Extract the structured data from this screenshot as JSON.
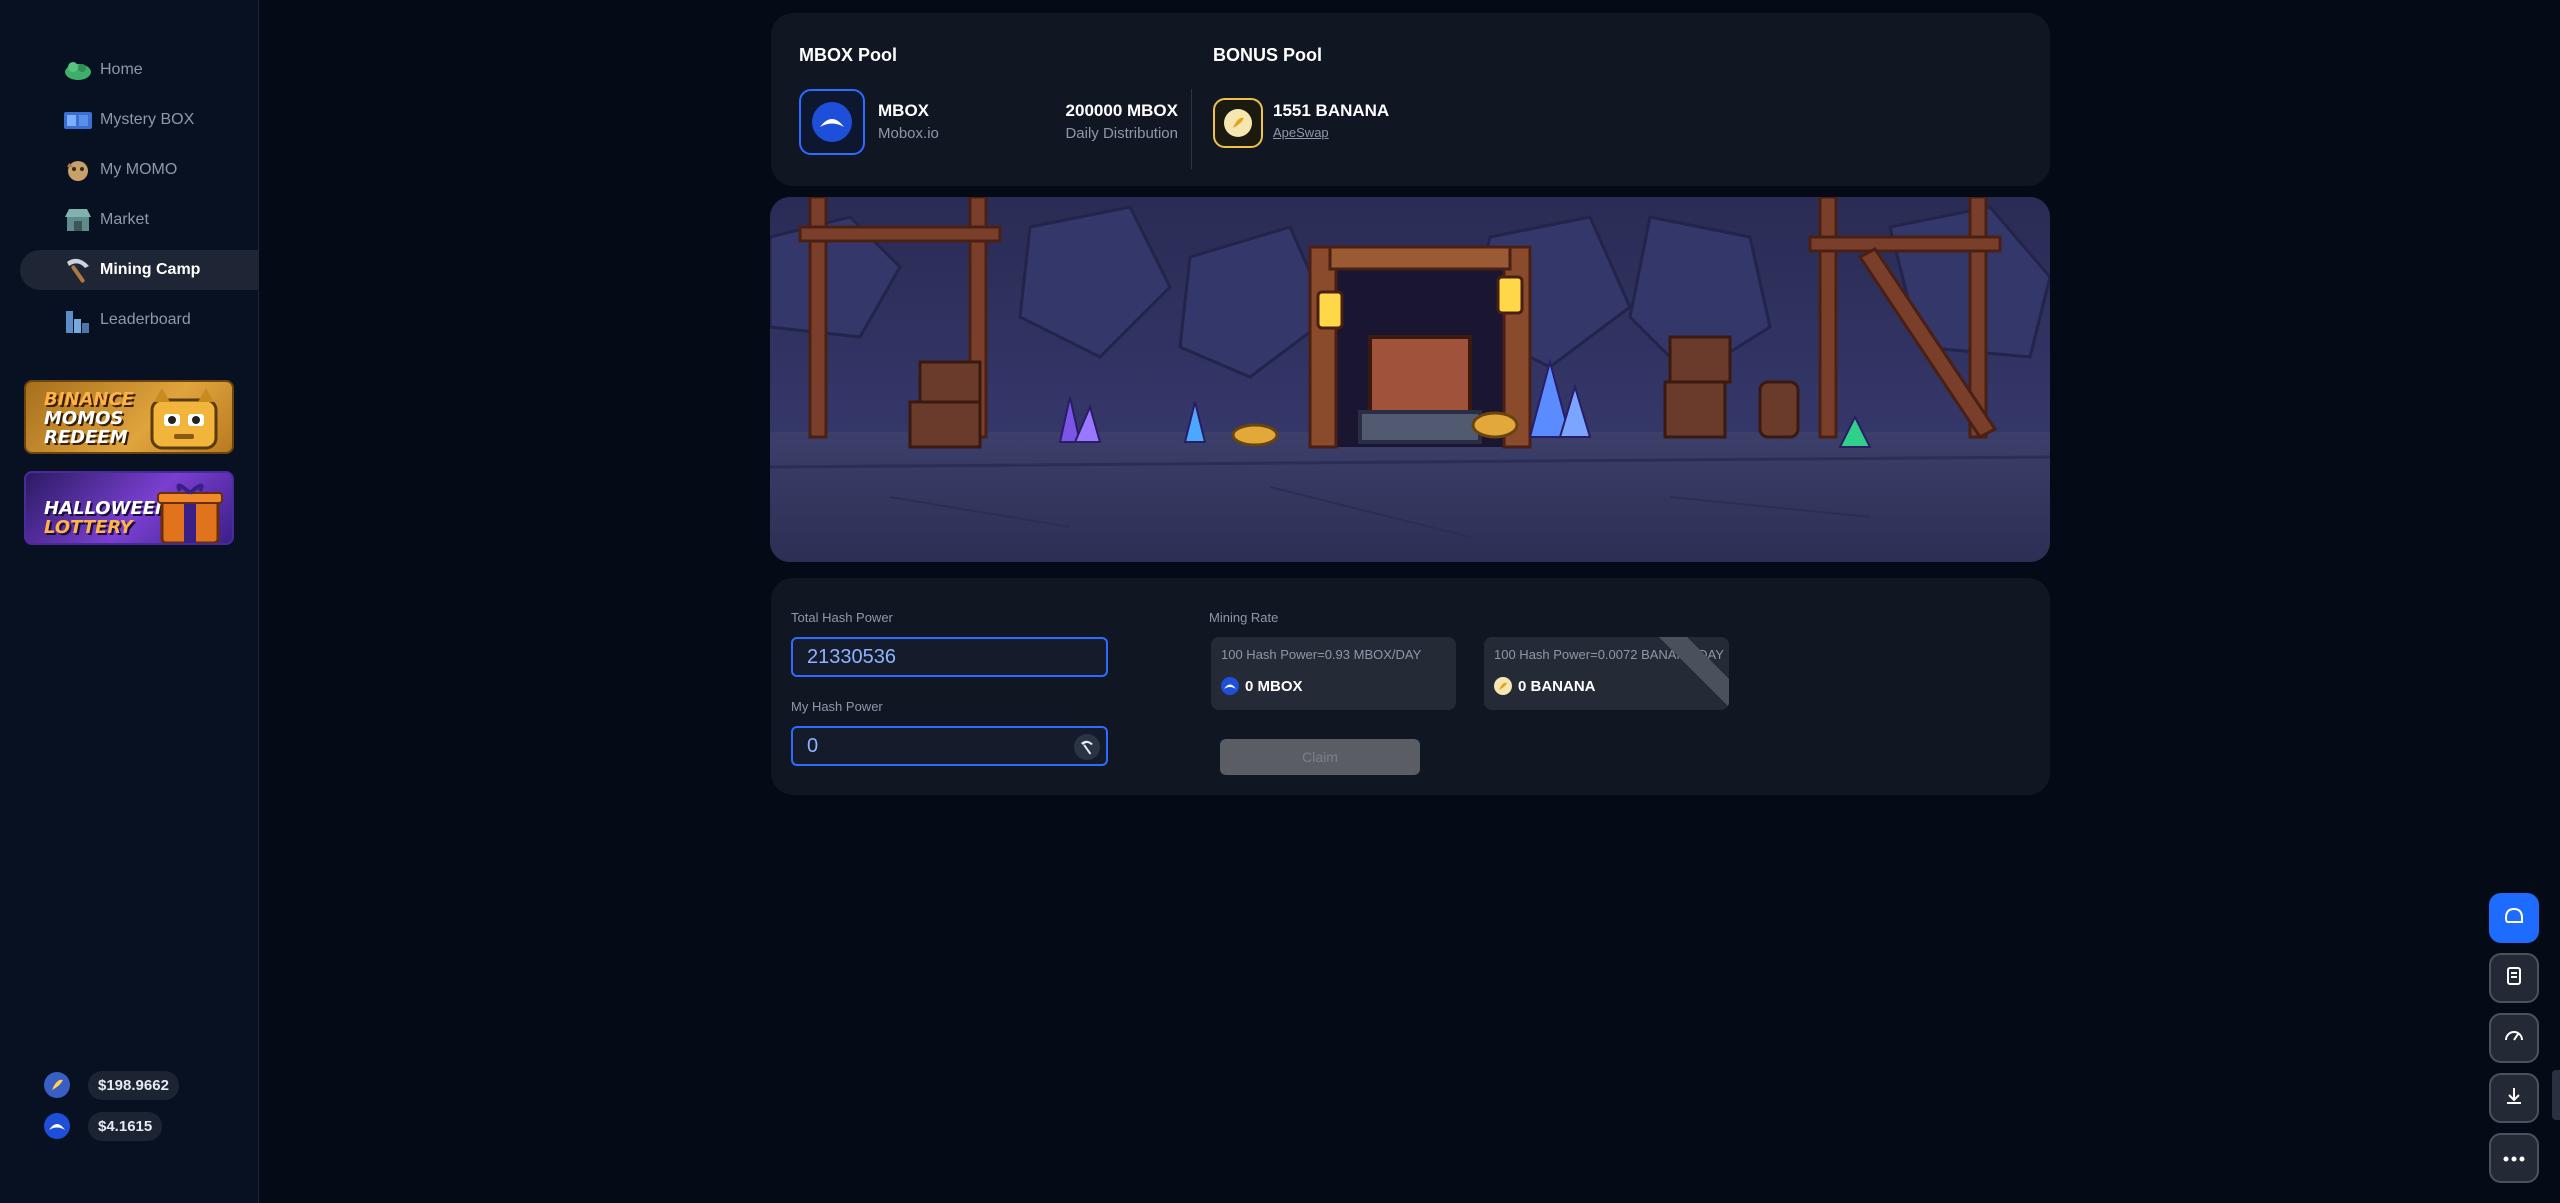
{
  "sidebar": {
    "items": [
      {
        "label": "Home",
        "icon": "home-icon"
      },
      {
        "label": "Mystery BOX",
        "icon": "mystery-box-icon"
      },
      {
        "label": "My MOMO",
        "icon": "momo-icon"
      },
      {
        "label": "Market",
        "icon": "market-icon"
      },
      {
        "label": "Mining Camp",
        "icon": "pickaxe-icon",
        "active": true
      },
      {
        "label": "Leaderboard",
        "icon": "leaderboard-icon"
      }
    ],
    "promos": {
      "binance": {
        "line1": "BINANCE",
        "line2": "MOMOS",
        "line3": "REDEEM"
      },
      "halloween": {
        "line1": "HALLOWEEN",
        "line2": "LOTTERY"
      }
    },
    "balances": [
      {
        "icon": "banana-coin-icon",
        "value": "$198.9662"
      },
      {
        "icon": "mbox-coin-icon",
        "value": "$4.1615"
      }
    ]
  },
  "pools": {
    "mbox": {
      "title": "MBOX Pool",
      "token": "MBOX",
      "site": "Mobox.io",
      "amount": "200000 MBOX",
      "amount_label": "Daily Distribution"
    },
    "bonus": {
      "title": "BONUS Pool",
      "amount": "1551 BANANA",
      "link": "ApeSwap"
    }
  },
  "hash": {
    "total_label": "Total Hash Power",
    "total_value": "21330536",
    "my_label": "My Hash Power",
    "my_value": "0",
    "mining_rate_label": "Mining Rate",
    "mbox_rate": "100 Hash Power=0.93 MBOX/DAY",
    "mbox_amount": "0 MBOX",
    "banana_rate": "100 Hash Power=0.0072 BANANA/DAY",
    "banana_amount": "0 BANANA",
    "claim_label": "Claim"
  },
  "colors": {
    "accent": "#1d6bff",
    "background": "#050b16",
    "card": "#101722"
  }
}
